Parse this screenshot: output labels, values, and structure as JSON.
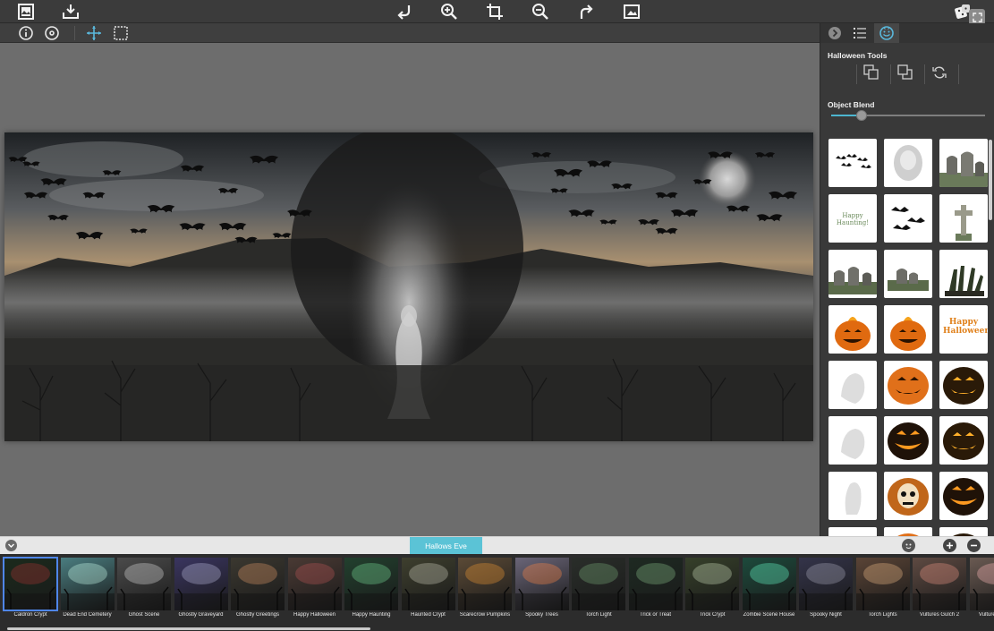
{
  "app": {
    "toolbar": {
      "icons": [
        "frame-icon",
        "save-icon",
        "undo-icon",
        "zoom-in-icon",
        "crop-icon",
        "zoom-out-icon",
        "redo-icon",
        "image-fit-icon",
        "dice-icon",
        "fullscreen-icon"
      ]
    },
    "sub_toolbar": {
      "icons": [
        "info-icon",
        "settings-icon",
        "move-icon",
        "select-rect-icon"
      ]
    },
    "panel": {
      "tabs": [
        "collapse-arrow-icon",
        "list-icon",
        "smiley-icon"
      ],
      "title": "Halloween Tools",
      "tool_icons": [
        "bring-forward-icon",
        "send-backward-icon",
        "rotate-icon"
      ],
      "blend_label": "Object Blend",
      "blend_level": 0.2,
      "thumbs": [
        {
          "kind": "bats"
        },
        {
          "kind": "ghost-blur"
        },
        {
          "kind": "tombstones"
        },
        {
          "kind": "text",
          "text": "Happy Haunting!"
        },
        {
          "kind": "bats2"
        },
        {
          "kind": "cross"
        },
        {
          "kind": "graves"
        },
        {
          "kind": "graves2"
        },
        {
          "kind": "zombie-hand"
        },
        {
          "kind": "pumpkin-fire"
        },
        {
          "kind": "pumpkin-fire"
        },
        {
          "kind": "text-orange",
          "text": "Happy Halloween"
        },
        {
          "kind": "ghost"
        },
        {
          "kind": "pumpkin"
        },
        {
          "kind": "pumpkin-dark"
        },
        {
          "kind": "ghost"
        },
        {
          "kind": "pumpkin-grin"
        },
        {
          "kind": "pumpkin-dark"
        },
        {
          "kind": "ghost2"
        },
        {
          "kind": "skull-pumpkin"
        },
        {
          "kind": "pumpkin-grin"
        },
        {
          "kind": "ghost"
        },
        {
          "kind": "pumpkin"
        },
        {
          "kind": "pumpkin-dark"
        }
      ]
    },
    "bottom": {
      "active_tab": "Hallows Eve",
      "icons": [
        "chevron-down-icon",
        "face-icon",
        "plus-icon",
        "minus-icon"
      ]
    },
    "filmstrip": [
      {
        "label": "Caldron Crypt",
        "color": "#1b2a1c",
        "accent": "#a33"
      },
      {
        "label": "Dead End Cemetery",
        "color": "#4a7d80",
        "accent": "#cfe"
      },
      {
        "label": "Ghost Scene",
        "color": "#4b4b4b",
        "accent": "#ddd"
      },
      {
        "label": "Ghostly Graveyard",
        "color": "#3a3560",
        "accent": "#bbd"
      },
      {
        "label": "Ghostly Greetings",
        "color": "#3b3830",
        "accent": "#d96"
      },
      {
        "label": "Happy Halloween",
        "color": "#4a3a34",
        "accent": "#b55"
      },
      {
        "label": "Happy Haunting",
        "color": "#22402e",
        "accent": "#7d9"
      },
      {
        "label": "Haunted Crypt",
        "color": "#3e3f2e",
        "accent": "#ccb"
      },
      {
        "label": "Scarecrow Pumpkins",
        "color": "#5b4a36",
        "accent": "#e93"
      },
      {
        "label": "Spooky Trees",
        "color": "#6a6578",
        "accent": "#f84"
      },
      {
        "label": "Torch Light",
        "color": "#2a2e2a",
        "accent": "#7a7"
      },
      {
        "label": "Trick or Treat",
        "color": "#1e2a22",
        "accent": "#8b8"
      },
      {
        "label": "Trick Crypt",
        "color": "#36402a",
        "accent": "#cdb"
      },
      {
        "label": "Zombie Scene House",
        "color": "#1d4a3c",
        "accent": "#6fc"
      },
      {
        "label": "Spooky Night",
        "color": "#34344a",
        "accent": "#aab"
      },
      {
        "label": "Torch Lights",
        "color": "#5a4436",
        "accent": "#eb8"
      },
      {
        "label": "Vultures Gulch 2",
        "color": "#5e4a42",
        "accent": "#e98"
      },
      {
        "label": "Vultures Gulch",
        "color": "#6a5a52",
        "accent": "#fbb"
      }
    ]
  }
}
